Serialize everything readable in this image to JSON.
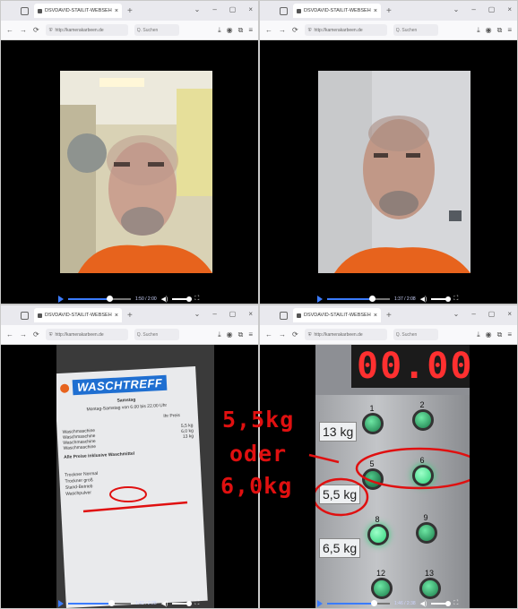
{
  "windows": [
    {
      "tab_title": "DSVDAVID-STAILIT-WEBSEHEN-RTUT-DEL",
      "address": "http://kamerakarbeen.de",
      "search_placeholder": "Q. Suchen",
      "video_time": "1:50 / 2:00"
    },
    {
      "tab_title": "DSVDAVID-STAILIT-WEBSEHEN-RTUT-DEL",
      "address": "http://kamerakarbeen.de",
      "search_placeholder": "Q. Suchen",
      "video_time": "1:37 / 2:08"
    },
    {
      "tab_title": "DSVDAVID-STAILIT-WEBSEHEN-RTUT-DEL",
      "address": "http://kamerakarbeen.de",
      "search_placeholder": "Q. Suchen",
      "video_time": "1:42 / 2:28"
    },
    {
      "tab_title": "DSVDAVID-STAILIT-WEBSEHEN-RTUT-DEL",
      "address": "http://kamerakarbeen.de",
      "search_placeholder": "Q. Suchen",
      "video_time": "1:46 / 2:38"
    }
  ],
  "receipt": {
    "brand": "WASCHTREFF",
    "line1": "Samstag",
    "line2": "Montag-Samstag von 6.00 bis 22.00 Uhr",
    "line3": "Ihr Preis",
    "row_labels": [
      "Waschmaschine",
      "Waschmaschine",
      "Waschmaschine",
      "Waschmaschine"
    ],
    "row_values": [
      "5,5 kg",
      "6,0 kg",
      "13 kg",
      ""
    ],
    "notice": "Alle Preise inklusive Waschmittel",
    "footer": [
      "Trockner Normal",
      "Trockner groß",
      "Stand-Betrieb",
      "Waschpulver"
    ]
  },
  "machine": {
    "display": "00.00",
    "buttons": [
      {
        "number": "1",
        "label": "13 kg"
      },
      {
        "number": "2",
        "label": ""
      },
      {
        "number": "5",
        "label": "5,5 kg"
      },
      {
        "number": "6",
        "label": ""
      },
      {
        "number": "8",
        "label": "6,5 kg"
      },
      {
        "number": "9",
        "label": ""
      },
      {
        "number": "12",
        "label": ""
      },
      {
        "number": "13",
        "label": ""
      }
    ]
  },
  "annotation": {
    "line1": "5,5kg",
    "line2": "oder",
    "line3": "6,0kg",
    "color": "#e01010"
  },
  "colors": {
    "accent": "#3b7cff",
    "led_green": "#2fd07a",
    "orange_shirt": "#e7631d"
  }
}
